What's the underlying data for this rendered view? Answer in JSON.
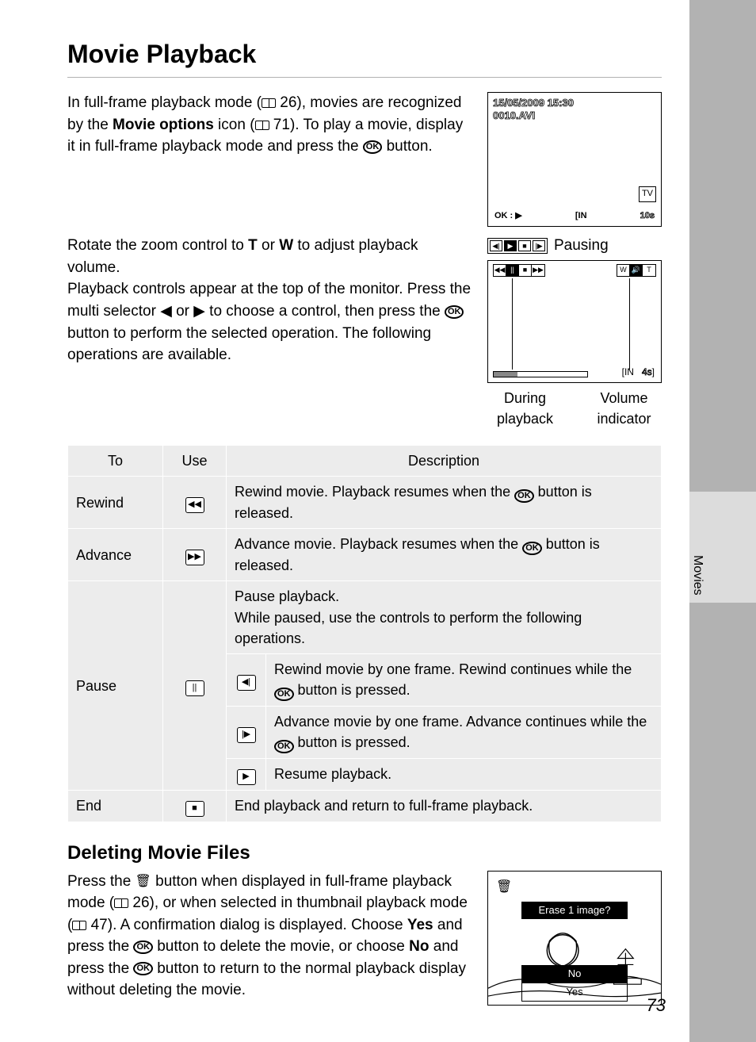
{
  "header": {
    "title": "Movie Playback"
  },
  "intro": {
    "text_before_ref1": "In full-frame playback mode (",
    "ref1": " 26), movies are recognized by the ",
    "bold1": "Movie options",
    "text_after_bold1": " icon (",
    "ref2": " 71). To play a movie, display it in full-frame playback mode and press the ",
    "after_ok": " button."
  },
  "screen1": {
    "date": "15/05/2009 15:30",
    "file": "0010.AVI",
    "tv": "TV",
    "ok": "OK : ▶",
    "mem": "IN",
    "time": "10s"
  },
  "volume": {
    "p1_a": "Rotate the zoom control to ",
    "t": "T",
    "p1_b": " or ",
    "w": "W",
    "p1_c": " to adjust playback volume.",
    "p2_a": "Playback controls appear at the top of the monitor. Press the multi selector ",
    "p2_b": " or ",
    "p2_c": " to choose a control, then press the ",
    "p2_d": " button to perform the selected operation. The following operations are available."
  },
  "pausing_label": "Pausing",
  "screen2": {
    "time": "4s",
    "in": "IN",
    "labels": {
      "during": "During playback",
      "volume": "Volume indicator"
    }
  },
  "table": {
    "headers": {
      "to": "To",
      "use": "Use",
      "desc": "Description"
    },
    "rows": {
      "rewind": {
        "to": "Rewind",
        "desc_a": "Rewind movie. Playback resumes when the ",
        "desc_b": " button is released."
      },
      "advance": {
        "to": "Advance",
        "desc_a": "Advance movie. Playback resumes when the ",
        "desc_b": " button is released."
      },
      "pause": {
        "to": "Pause",
        "desc_intro": "Pause playback.\nWhile paused, use the controls to perform the following operations.",
        "sub_rewind_a": "Rewind movie by one frame. Rewind continues while the ",
        "sub_rewind_b": " button is pressed.",
        "sub_advance_a": "Advance movie by one frame. Advance continues while the ",
        "sub_advance_b": " button is pressed.",
        "sub_resume": "Resume playback."
      },
      "end": {
        "to": "End",
        "desc": "End playback and return to full-frame playback."
      }
    }
  },
  "delete": {
    "title": "Deleting Movie Files",
    "p_a": "Press the ",
    "p_b": " button when displayed in full-frame playback mode (",
    "ref1": " 26), or when selected in thumbnail playback mode (",
    "ref2": " 47). A confirmation dialog is displayed. Choose ",
    "yes": "Yes",
    "p_c": " and press the ",
    "p_d": " button to delete the movie, or choose ",
    "no": "No",
    "p_e": " and press the ",
    "p_f": " button to return to the normal playback display without deleting the movie."
  },
  "delete_screen": {
    "prompt": "Erase 1 image?",
    "no": "No",
    "yes": "Yes"
  },
  "side_tab": "Movies",
  "page_num": "73"
}
